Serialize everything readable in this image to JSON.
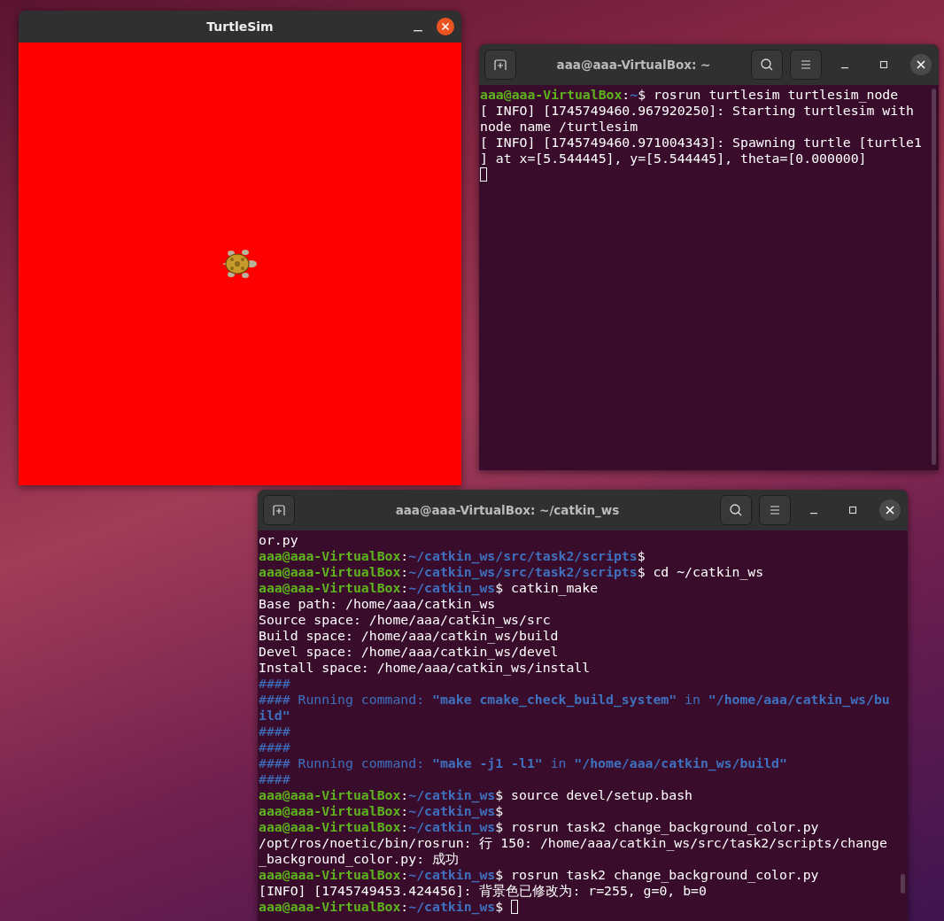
{
  "windows": [
    {
      "kind": "turtlesim",
      "title": "TurtleSim"
    },
    {
      "kind": "terminal",
      "title": "aaa@aaa-VirtualBox: ~",
      "lines": [
        [
          {
            "kind": "user",
            "text": "aaa@aaa-VirtualBox"
          },
          {
            "kind": "plain",
            "text": ":"
          },
          {
            "kind": "path",
            "text": "~"
          },
          {
            "kind": "plain",
            "text": "$ rosrun turtlesim turtlesim_node"
          }
        ],
        [
          {
            "kind": "plain",
            "text": "[ INFO] [1745749460.967920250]: Starting turtlesim with"
          }
        ],
        [
          {
            "kind": "plain",
            "text": "node name /turtlesim"
          }
        ],
        [
          {
            "kind": "plain",
            "text": "[ INFO] [1745749460.971004343]: Spawning turtle [turtle1"
          }
        ],
        [
          {
            "kind": "plain",
            "text": "] at x=[5.544445], y=[5.544445], theta=[0.000000]"
          }
        ],
        [
          {
            "kind": "cursor"
          }
        ]
      ]
    },
    {
      "kind": "terminal",
      "title": "aaa@aaa-VirtualBox: ~/catkin_ws",
      "lines": [
        [
          {
            "kind": "plain",
            "text": "or.py"
          }
        ],
        [
          {
            "kind": "user",
            "text": "aaa@aaa-VirtualBox"
          },
          {
            "kind": "plain",
            "text": ":"
          },
          {
            "kind": "path",
            "text": "~/catkin_ws/src/task2/scripts"
          },
          {
            "kind": "plain",
            "text": "$"
          }
        ],
        [
          {
            "kind": "user",
            "text": "aaa@aaa-VirtualBox"
          },
          {
            "kind": "plain",
            "text": ":"
          },
          {
            "kind": "path",
            "text": "~/catkin_ws/src/task2/scripts"
          },
          {
            "kind": "plain",
            "text": "$ cd ~/catkin_ws"
          }
        ],
        [
          {
            "kind": "user",
            "text": "aaa@aaa-VirtualBox"
          },
          {
            "kind": "plain",
            "text": ":"
          },
          {
            "kind": "path",
            "text": "~/catkin_ws"
          },
          {
            "kind": "plain",
            "text": "$ catkin_make"
          }
        ],
        [
          {
            "kind": "plain",
            "text": "Base path: /home/aaa/catkin_ws"
          }
        ],
        [
          {
            "kind": "plain",
            "text": "Source space: /home/aaa/catkin_ws/src"
          }
        ],
        [
          {
            "kind": "plain",
            "text": "Build space: /home/aaa/catkin_ws/build"
          }
        ],
        [
          {
            "kind": "plain",
            "text": "Devel space: /home/aaa/catkin_ws/devel"
          }
        ],
        [
          {
            "kind": "plain",
            "text": "Install space: /home/aaa/catkin_ws/install"
          }
        ],
        [
          {
            "kind": "hash",
            "text": "####"
          }
        ],
        [
          {
            "kind": "hash",
            "text": "#### Running command: "
          },
          {
            "kind": "quoted",
            "text": "\"make cmake_check_build_system\""
          },
          {
            "kind": "hash",
            "text": " in "
          },
          {
            "kind": "quoted",
            "text": "\"/home/aaa/catkin_ws/bu"
          }
        ],
        [
          {
            "kind": "quoted",
            "text": "ild\""
          }
        ],
        [
          {
            "kind": "hash",
            "text": "####"
          }
        ],
        [
          {
            "kind": "hash",
            "text": "####"
          }
        ],
        [
          {
            "kind": "hash",
            "text": "#### Running command: "
          },
          {
            "kind": "quoted",
            "text": "\"make -j1 -l1\""
          },
          {
            "kind": "hash",
            "text": " in "
          },
          {
            "kind": "quoted",
            "text": "\"/home/aaa/catkin_ws/build\""
          }
        ],
        [
          {
            "kind": "hash",
            "text": "####"
          }
        ],
        [
          {
            "kind": "user",
            "text": "aaa@aaa-VirtualBox"
          },
          {
            "kind": "plain",
            "text": ":"
          },
          {
            "kind": "path",
            "text": "~/catkin_ws"
          },
          {
            "kind": "plain",
            "text": "$ source devel/setup.bash"
          }
        ],
        [
          {
            "kind": "user",
            "text": "aaa@aaa-VirtualBox"
          },
          {
            "kind": "plain",
            "text": ":"
          },
          {
            "kind": "path",
            "text": "~/catkin_ws"
          },
          {
            "kind": "plain",
            "text": "$"
          }
        ],
        [
          {
            "kind": "user",
            "text": "aaa@aaa-VirtualBox"
          },
          {
            "kind": "plain",
            "text": ":"
          },
          {
            "kind": "path",
            "text": "~/catkin_ws"
          },
          {
            "kind": "plain",
            "text": "$ rosrun task2 change_background_color.py"
          }
        ],
        [
          {
            "kind": "plain",
            "text": "/opt/ros/noetic/bin/rosrun: 行 150: /home/aaa/catkin_ws/src/task2/scripts/change"
          }
        ],
        [
          {
            "kind": "plain",
            "text": "_background_color.py: 成功"
          }
        ],
        [
          {
            "kind": "user",
            "text": "aaa@aaa-VirtualBox"
          },
          {
            "kind": "plain",
            "text": ":"
          },
          {
            "kind": "path",
            "text": "~/catkin_ws"
          },
          {
            "kind": "plain",
            "text": "$ rosrun task2 change_background_color.py"
          }
        ],
        [
          {
            "kind": "plain",
            "text": "[INFO] [1745749453.424456]: 背景色已修改为: r=255, g=0, b=0"
          }
        ],
        [
          {
            "kind": "user",
            "text": "aaa@aaa-VirtualBox"
          },
          {
            "kind": "plain",
            "text": ":"
          },
          {
            "kind": "path",
            "text": "~/catkin_ws"
          },
          {
            "kind": "plain",
            "text": "$ "
          },
          {
            "kind": "cursor"
          }
        ]
      ]
    }
  ]
}
